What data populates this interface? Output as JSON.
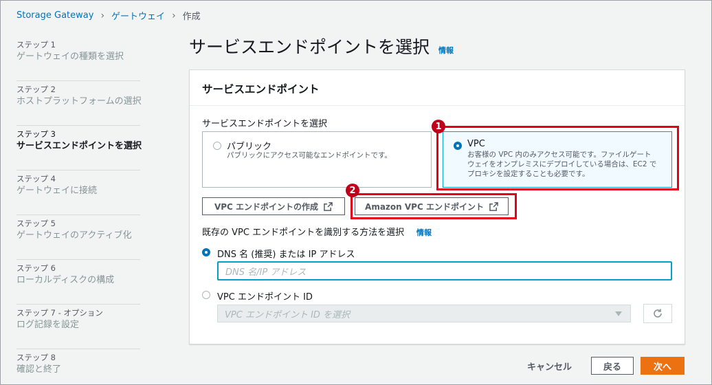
{
  "breadcrumb": {
    "root": "Storage Gateway",
    "parent": "ゲートウェイ",
    "current": "作成"
  },
  "steps": [
    {
      "num": "ステップ 1",
      "title": "ゲートウェイの種類を選択"
    },
    {
      "num": "ステップ 2",
      "title": "ホストプラットフォームの選択"
    },
    {
      "num": "ステップ 3",
      "title": "サービスエンドポイントを選択"
    },
    {
      "num": "ステップ 4",
      "title": "ゲートウェイに接続"
    },
    {
      "num": "ステップ 5",
      "title": "ゲートウェイのアクティブ化"
    },
    {
      "num": "ステップ 6",
      "title": "ローカルディスクの構成"
    },
    {
      "num": "ステップ 7 - オプション",
      "title": "ログ記録を設定"
    },
    {
      "num": "ステップ 8",
      "title": "確認と終了"
    }
  ],
  "active_step": 3,
  "page": {
    "title": "サービスエンドポイントを選択",
    "info": "情報"
  },
  "panel": {
    "header": "サービスエンドポイント",
    "select_label": "サービスエンドポイントを選択",
    "public_tile": {
      "title": "パブリック",
      "desc": "パブリックにアクセス可能なエンドポイントです。"
    },
    "vpc_tile": {
      "title": "VPC",
      "desc_lines": [
        "お客様の VPC 内のみアクセス可能です。ファイルゲート",
        "ウェイをオンプレミスにデプロイしている場合は、EC2 で",
        "プロキシを設定することも必要です。"
      ]
    },
    "selected_endpoint": "VPC",
    "create_vpc_button": "VPC エンドポイントの作成",
    "amazon_vpc_button": "Amazon VPC エンドポイント",
    "identify_label": "既存の VPC エンドポイントを識別する方法を選択",
    "identify_info": "情報",
    "dns_option": "DNS 名 (推奨) または IP アドレス",
    "dns_placeholder": "DNS 名/IP アドレス",
    "id_option": "VPC エンドポイント ID",
    "id_select_placeholder": "VPC エンドポイント ID を選択",
    "selected_identify": "DNS"
  },
  "footer": {
    "cancel": "キャンセル",
    "back": "戻る",
    "next": "次へ"
  },
  "annotations": {
    "badge1": "1",
    "badge2": "2"
  },
  "colors": {
    "link": "#0073bb",
    "primary": "#ec7211",
    "annotation": "#e3001b",
    "selected_tile_bg": "#f1faff"
  },
  "icons": [
    "chevron-right-icon",
    "external-link-icon",
    "refresh-icon",
    "caret-down-icon"
  ]
}
